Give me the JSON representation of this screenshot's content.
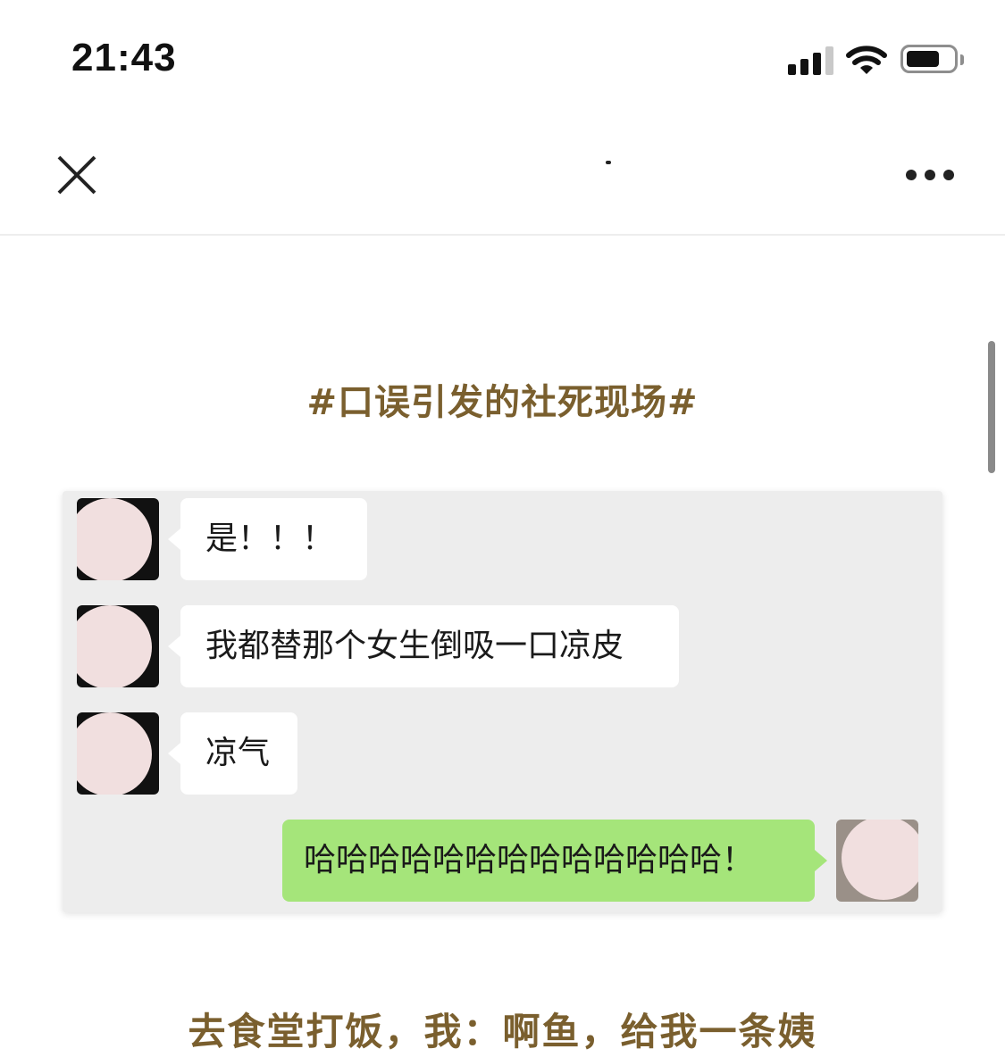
{
  "status_bar": {
    "time": "21:43",
    "icons": [
      "signal-icon",
      "wifi-icon",
      "battery-icon"
    ]
  },
  "nav_bar": {
    "close_icon": "close-icon",
    "more_icon": "more-icon"
  },
  "article": {
    "heading": "#口误引发的社死现场#",
    "chat": [
      {
        "side": "left",
        "text": "是！！！"
      },
      {
        "side": "left",
        "text": "我都替那个女生倒吸一口凉皮"
      },
      {
        "side": "left",
        "text": "凉气"
      },
      {
        "side": "right",
        "text": "哈哈哈哈哈哈哈哈哈哈哈哈哈！"
      }
    ],
    "body_line": "去食堂打饭，我：啊鱼，给我一条姨"
  },
  "colors": {
    "accent_text": "#7a5f2e",
    "outgoing_bubble": "#a5e57a",
    "incoming_bubble": "#ffffff",
    "chat_background": "#ededed"
  }
}
